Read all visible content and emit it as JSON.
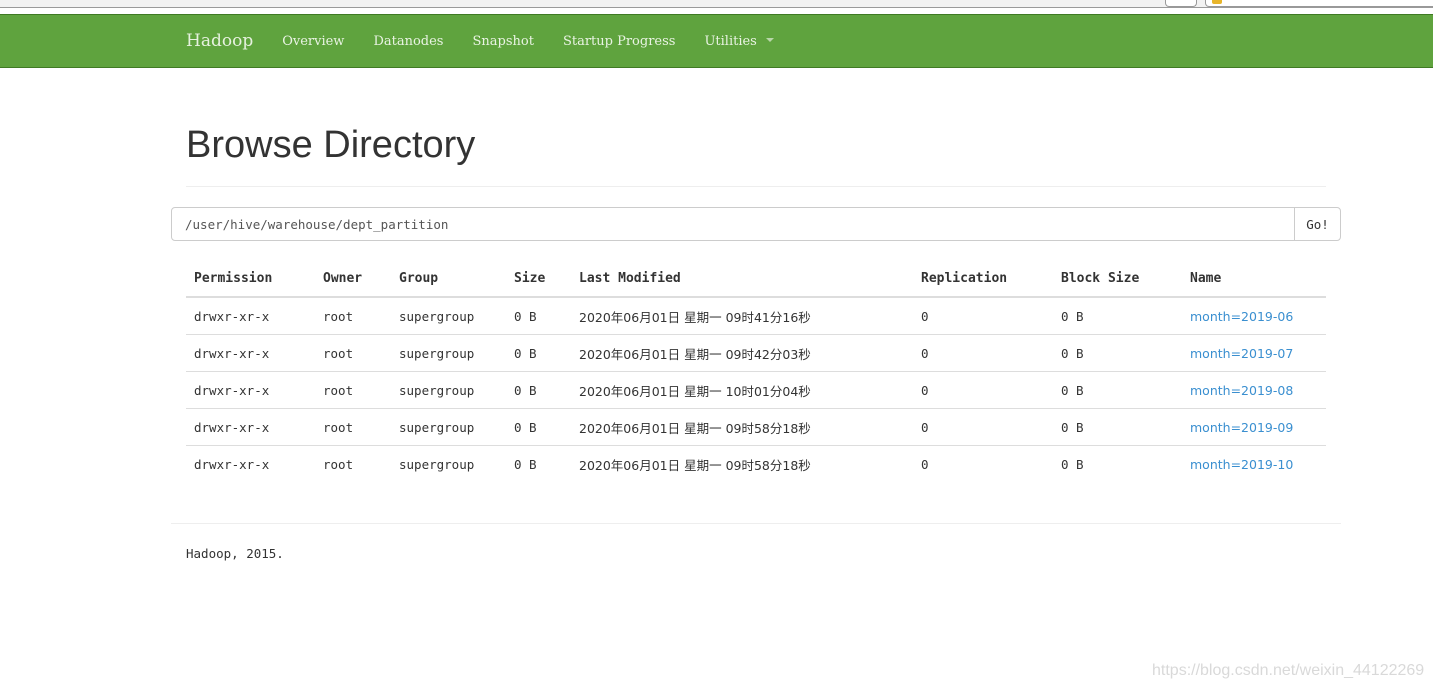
{
  "navbar": {
    "brand": "Hadoop",
    "items": [
      {
        "label": "Overview"
      },
      {
        "label": "Datanodes"
      },
      {
        "label": "Snapshot"
      },
      {
        "label": "Startup Progress"
      },
      {
        "label": "Utilities"
      }
    ],
    "color": "#5fa33e"
  },
  "page": {
    "title": "Browse Directory",
    "path_value": "/user/hive/warehouse/dept_partition",
    "go_label": "Go!"
  },
  "table": {
    "headers": [
      "Permission",
      "Owner",
      "Group",
      "Size",
      "Last Modified",
      "Replication",
      "Block Size",
      "Name"
    ],
    "rows": [
      {
        "permission": "drwxr-xr-x",
        "owner": "root",
        "group": "supergroup",
        "size": "0 B",
        "modified": "2020年06月01日 星期一 09时41分16秒",
        "replication": "0",
        "block_size": "0 B",
        "name": "month=2019-06"
      },
      {
        "permission": "drwxr-xr-x",
        "owner": "root",
        "group": "supergroup",
        "size": "0 B",
        "modified": "2020年06月01日 星期一 09时42分03秒",
        "replication": "0",
        "block_size": "0 B",
        "name": "month=2019-07"
      },
      {
        "permission": "drwxr-xr-x",
        "owner": "root",
        "group": "supergroup",
        "size": "0 B",
        "modified": "2020年06月01日 星期一 10时01分04秒",
        "replication": "0",
        "block_size": "0 B",
        "name": "month=2019-08"
      },
      {
        "permission": "drwxr-xr-x",
        "owner": "root",
        "group": "supergroup",
        "size": "0 B",
        "modified": "2020年06月01日 星期一 09时58分18秒",
        "replication": "0",
        "block_size": "0 B",
        "name": "month=2019-09"
      },
      {
        "permission": "drwxr-xr-x",
        "owner": "root",
        "group": "supergroup",
        "size": "0 B",
        "modified": "2020年06月01日 星期一 09时58分18秒",
        "replication": "0",
        "block_size": "0 B",
        "name": "month=2019-10"
      }
    ],
    "link_color": "#3a8fd0"
  },
  "footer": {
    "text": "Hadoop, 2015."
  },
  "watermark": "https://blog.csdn.net/weixin_44122269"
}
